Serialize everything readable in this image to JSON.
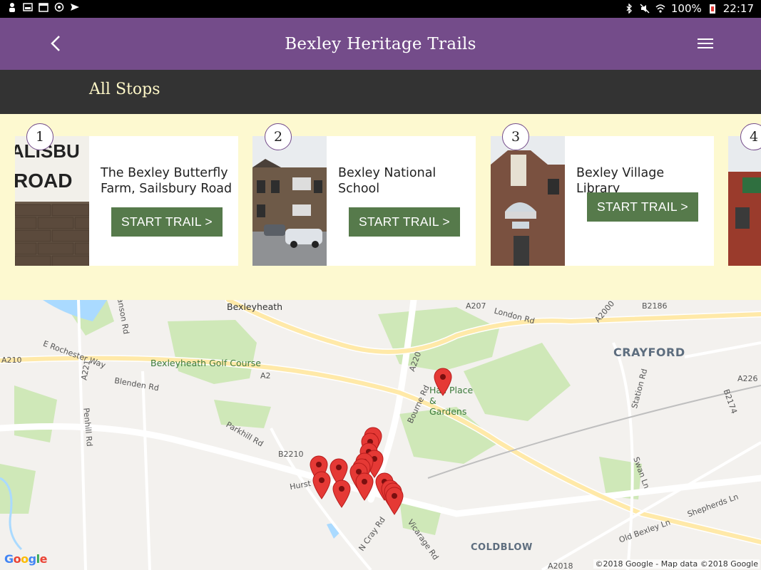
{
  "status_bar": {
    "battery": "100%",
    "time": "22:17"
  },
  "app_bar": {
    "title": "Bexley Heritage Trails",
    "back_icon": "chevron-left-icon",
    "menu_icon": "hamburger-menu-icon"
  },
  "section": {
    "title": "All Stops"
  },
  "stops": [
    {
      "number": "1",
      "name": "The Bexley Butterfly Farm, Sailsbury Road",
      "button": "START TRAIL >"
    },
    {
      "number": "2",
      "name": "Bexley National School",
      "button": "START TRAIL >"
    },
    {
      "number": "3",
      "name": "Bexley Village Library",
      "button": "START TRAIL >"
    },
    {
      "number": "4"
    }
  ],
  "map": {
    "places": [
      "Bexleyheath",
      "CRAYFORD",
      "COLDBLOW",
      "Bexleyheath Golf Course",
      "Hall Place & Gardens"
    ],
    "roads": [
      "Danson Rd",
      "E Rochester Way",
      "A210",
      "A221",
      "Blenden Rd",
      "A2",
      "A220",
      "A207",
      "London Rd",
      "A2000",
      "B2186",
      "Penhill Rd",
      "Parkhill Rd",
      "B2210",
      "Bourne Rd",
      "Station Rd",
      "A226",
      "B2174",
      "Swan Ln",
      "Shepherds Ln",
      "Old Bexley Ln",
      "Hurst Rd",
      "N Cray Rd",
      "Vicarage Rd",
      "A2018"
    ],
    "google_logo": "Google",
    "copyright": "©2018 Google - Map data ©2018 Google"
  },
  "colors": {
    "app_bar": "#744c8a",
    "section_bar": "#333333",
    "section_title": "#fff8c8",
    "strip_bg": "#fdf9d0",
    "button": "#567a4b",
    "pin": "#e53935"
  }
}
